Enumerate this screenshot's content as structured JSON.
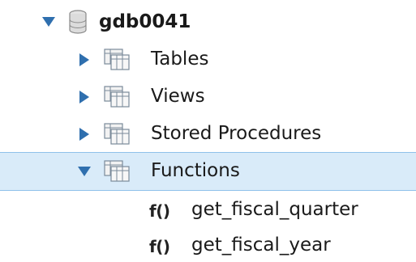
{
  "tree": {
    "database": {
      "name": "gdb0041",
      "expanded": true
    },
    "folders": [
      {
        "label": "Tables",
        "expanded": false
      },
      {
        "label": "Views",
        "expanded": false
      },
      {
        "label": "Stored Procedures",
        "expanded": false
      },
      {
        "label": "Functions",
        "expanded": true,
        "selected": true
      }
    ],
    "functions": [
      {
        "glyph": "f()",
        "label": "get_fiscal_quarter"
      },
      {
        "glyph": "f()",
        "label": "get_fiscal_year"
      }
    ]
  },
  "colors": {
    "arrow": "#2f6fae",
    "selection_bg": "#d9ebf9",
    "selection_border": "#8fc1ea"
  },
  "icons": {
    "database": "database-icon",
    "folder": "folder-grid-icon",
    "function": "function-icon"
  }
}
